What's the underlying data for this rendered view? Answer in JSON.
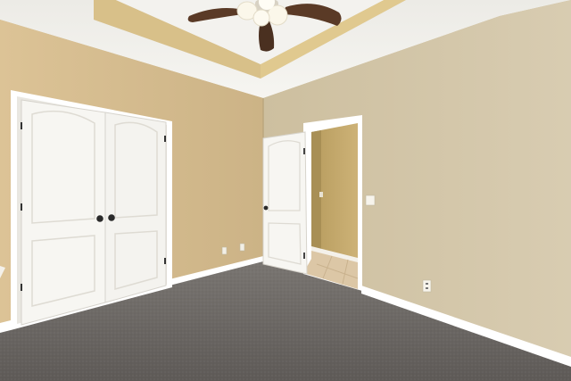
{
  "scene": {
    "colors": {
      "ceiling": "#f2f0ec",
      "ceiling_shadow": "#dcd8d0",
      "tray_edge": "#d9c08a",
      "left_wall": "#d6bd8f",
      "back_wall": "#cfbe9a",
      "right_wall": "#d2c5a9",
      "hall_wall": "#c4a96a",
      "door_white": "#f7f6f2",
      "door_shadow": "#e3e0d8",
      "trim": "#ffffff",
      "carpet": "#75716d",
      "carpet_dark": "#5f5b58",
      "tile_floor": "#dcc7a6",
      "fan_blade": "#5a3a26",
      "fan_light": "#fbf7ea",
      "knob": "#2a2a2a"
    },
    "icons": [
      "ceiling-fan-icon",
      "door-knob-icon",
      "outlet-icon",
      "light-switch-icon"
    ]
  }
}
